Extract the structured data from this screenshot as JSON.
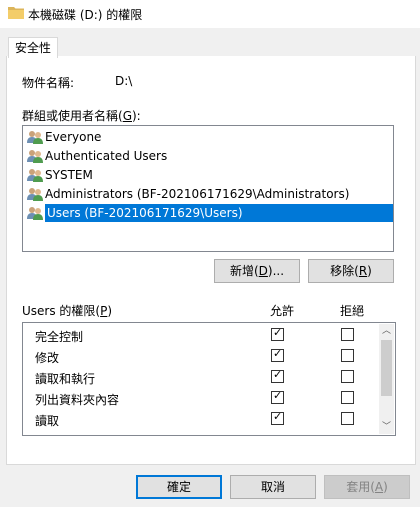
{
  "window": {
    "title": "本機磁碟 (D:) 的權限"
  },
  "tabs": [
    {
      "label": "安全性"
    }
  ],
  "object": {
    "name_label": "物件名稱:",
    "name_value": "D:\\"
  },
  "users": {
    "label_prefix": "群組或使用者名稱(",
    "label_key": "G",
    "label_suffix": "):",
    "items": [
      {
        "label": "Everyone",
        "icon": "user-group-icon",
        "selected": false
      },
      {
        "label": "Authenticated Users",
        "icon": "user-group-icon",
        "selected": false
      },
      {
        "label": "SYSTEM",
        "icon": "user-group-icon",
        "selected": false
      },
      {
        "label": "Administrators (BF-202106171629\\Administrators)",
        "icon": "user-group-icon",
        "selected": false
      },
      {
        "label": "Users (BF-202106171629\\Users)",
        "icon": "user-group-icon",
        "selected": true
      }
    ]
  },
  "actions": {
    "add_prefix": "新增(",
    "add_key": "D",
    "add_suffix": ")...",
    "remove_prefix": "移除(",
    "remove_key": "R",
    "remove_suffix": ")"
  },
  "permissions": {
    "label_prefix": "Users 的權限(",
    "label_key": "P",
    "label_suffix": ")",
    "allow_header": "允許",
    "deny_header": "拒絕",
    "rows": [
      {
        "name": "完全控制",
        "allow": true,
        "deny": false
      },
      {
        "name": "修改",
        "allow": true,
        "deny": false
      },
      {
        "name": "讀取和執行",
        "allow": true,
        "deny": false
      },
      {
        "name": "列出資料夾內容",
        "allow": true,
        "deny": false
      },
      {
        "name": "讀取",
        "allow": true,
        "deny": false
      }
    ]
  },
  "footer": {
    "ok": "確定",
    "cancel": "取消",
    "apply_prefix": "套用(",
    "apply_key": "A",
    "apply_suffix": ")"
  },
  "colors": {
    "selection": "#0078d7",
    "default_button_border": "#0078d7"
  }
}
